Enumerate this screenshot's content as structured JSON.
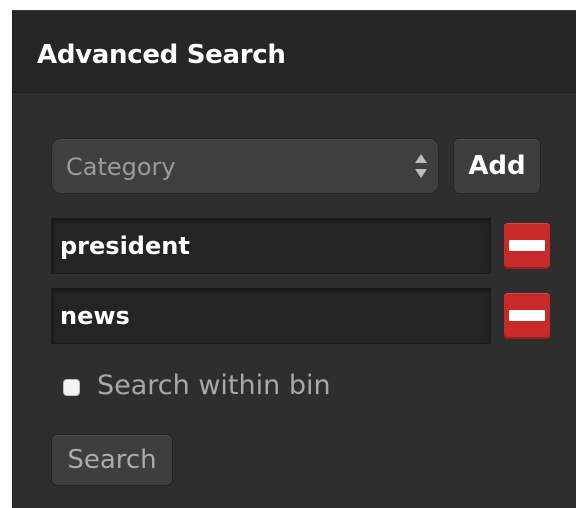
{
  "panel": {
    "title": "Advanced Search"
  },
  "category_select": {
    "selected": "Category",
    "icon": "up-down-arrows-icon"
  },
  "add_button": {
    "label": "Add"
  },
  "terms": [
    {
      "value": "president",
      "remove_icon": "minus-icon"
    },
    {
      "value": "news",
      "remove_icon": "minus-icon"
    }
  ],
  "search_within_bin": {
    "label": "Search within bin",
    "checked": false
  },
  "search_button": {
    "label": "Search"
  },
  "colors": {
    "panel_background": "#2e2e2e",
    "titlebar_background": "#262626",
    "remove_red": "#c82a2a",
    "text_white": "#ffffff",
    "text_muted": "#a8a8a8"
  }
}
